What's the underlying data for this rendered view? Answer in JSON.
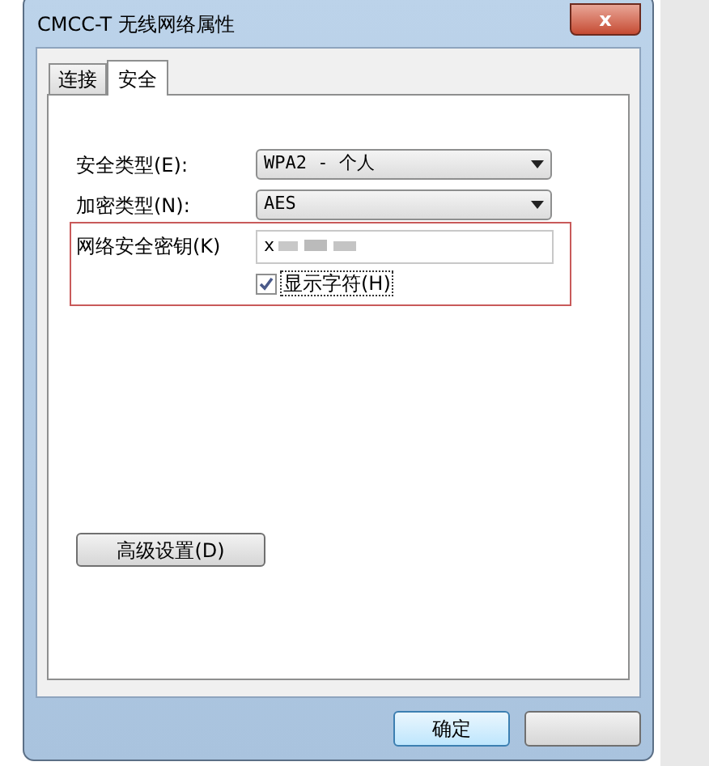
{
  "window": {
    "title": "CMCC-T 无线网络属性",
    "close": "x"
  },
  "tabs": [
    {
      "label": "连接",
      "selected": false
    },
    {
      "label": "安全",
      "selected": true
    }
  ],
  "security_type": {
    "label": "安全类型(E):",
    "value": "WPA2 - 个人"
  },
  "encryption_type": {
    "label": "加密类型(N):",
    "value": "AES"
  },
  "network_key": {
    "label": "网络安全密钥(K)",
    "value": "x"
  },
  "show_characters": {
    "label": "显示字符(H)",
    "checked": true
  },
  "advanced_button": "高级设置(D)",
  "buttons": [
    "确定"
  ]
}
